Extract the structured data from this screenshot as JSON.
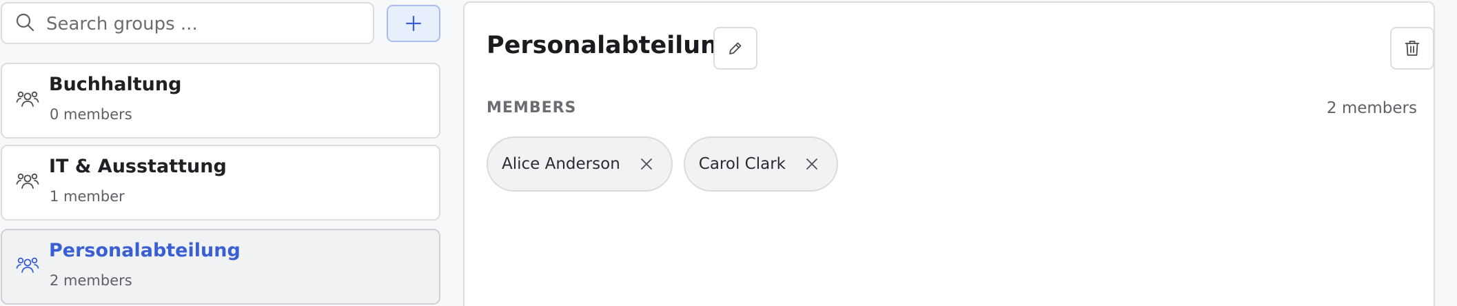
{
  "search": {
    "placeholder": "Search groups ...",
    "value": "",
    "icon": "search-icon"
  },
  "add_button": {
    "icon": "plus-icon"
  },
  "groups": [
    {
      "name": "Buchhaltung",
      "count": "0 members",
      "icon": "users-group-icon",
      "selected": false
    },
    {
      "name": "IT & Ausstattung",
      "count": "1 member",
      "icon": "users-group-icon",
      "selected": false
    },
    {
      "name": "Personalabteilung",
      "count": "2 members",
      "icon": "users-group-icon",
      "selected": true
    }
  ],
  "detail": {
    "title": "Personalabteilung",
    "members_heading": "MEMBERS",
    "members_count": "2 members",
    "members": [
      {
        "name": "Alice Anderson"
      },
      {
        "name": "Carol Clark"
      }
    ]
  },
  "colors": {
    "accent": "#3a5fd4",
    "add_button_bg": "#e7eefc",
    "selected_bg": "#f1f2f4",
    "chip_bg": "#f1f2f4"
  }
}
